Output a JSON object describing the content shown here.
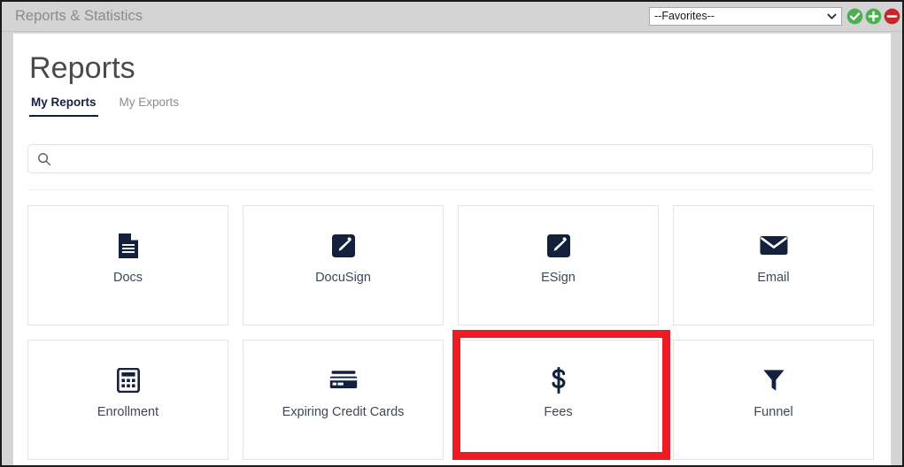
{
  "window": {
    "app_title": "Reports & Statistics"
  },
  "toolbar": {
    "favorites_select": {
      "name": "favorites-dropdown",
      "selected": "--Favorites--",
      "options": [
        "--Favorites--"
      ]
    },
    "icons": [
      {
        "name": "confirm-favorite-icon",
        "glyph": "check",
        "color": "#4caf50"
      },
      {
        "name": "add-favorite-icon",
        "glyph": "plus",
        "color": "#4caf50"
      },
      {
        "name": "remove-favorite-icon",
        "glyph": "minus",
        "color": "#c62828"
      }
    ]
  },
  "page": {
    "title": "Reports"
  },
  "tabs": [
    {
      "label": "My Reports",
      "active": true
    },
    {
      "label": "My Exports",
      "active": false
    }
  ],
  "search": {
    "icon": "search-icon",
    "value": "",
    "placeholder": ""
  },
  "cards": [
    {
      "label": "Docs",
      "icon": "document-icon",
      "highlighted": false
    },
    {
      "label": "DocuSign",
      "icon": "pencil-square-icon",
      "highlighted": false
    },
    {
      "label": "ESign",
      "icon": "pencil-square-icon",
      "highlighted": false
    },
    {
      "label": "Email",
      "icon": "envelope-icon",
      "highlighted": false
    },
    {
      "label": "Enrollment",
      "icon": "calculator-icon",
      "highlighted": false
    },
    {
      "label": "Expiring Credit Cards",
      "icon": "credit-card-icon",
      "highlighted": false
    },
    {
      "label": "Fees",
      "icon": "dollar-sign-icon",
      "highlighted": true
    },
    {
      "label": "Funnel",
      "icon": "funnel-icon",
      "highlighted": false
    }
  ],
  "annotation": {
    "name": "fees-highlight-box",
    "color": "#ed1c24",
    "target": "Fees"
  },
  "theme": {
    "icon_navy": "#14213d",
    "chrome_gray": "#d4d4d4",
    "accent_red": "#ed1c24"
  }
}
